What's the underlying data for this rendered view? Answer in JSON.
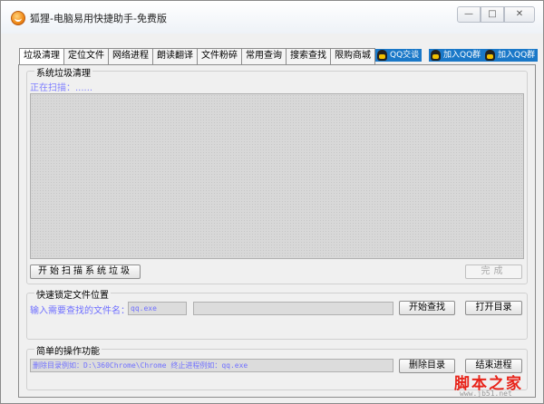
{
  "window": {
    "title": "狐狸-电脑易用快捷助手-免费版",
    "controls": {
      "minimize": "—",
      "maximize": "□",
      "close": "✕"
    }
  },
  "tabs": [
    {
      "label": "垃圾清理",
      "active": true
    },
    {
      "label": "定位文件",
      "active": false
    },
    {
      "label": "网络进程",
      "active": false
    },
    {
      "label": "朗读翻译",
      "active": false
    },
    {
      "label": "文件粉碎",
      "active": false
    },
    {
      "label": "常用查询",
      "active": false
    },
    {
      "label": "搜索查找",
      "active": false
    },
    {
      "label": "限购商城",
      "active": false
    }
  ],
  "qq_buttons": {
    "chat": {
      "label": "QQ交谈",
      "icon": "qq-icon"
    },
    "join1": {
      "label": "加入QQ群",
      "icon": "qq-group-icon"
    },
    "join2": {
      "label": "加入QQ群",
      "icon": "qq-group-icon"
    }
  },
  "junk_clean": {
    "title": "系统垃圾清理",
    "status": "正在扫描：......",
    "scan_button": "开始扫描系统垃圾",
    "finish_button": "完成"
  },
  "locate_file": {
    "title": "快速锁定文件位置",
    "prompt": "输入需要查找的文件名：",
    "filename_value": "qq.exe",
    "result_value": "",
    "find_button": "开始查找",
    "open_dir_button": "打开目录"
  },
  "simple_ops": {
    "title": "简单的操作功能",
    "command_value": "删除目录例如：D:\\360Chrome\\Chrome 终止进程例如：qq.exe",
    "delete_dir_button": "删除目录",
    "kill_process_button": "结束进程"
  },
  "watermark": {
    "text": "脚本之家",
    "url": "www.jb51.net"
  }
}
